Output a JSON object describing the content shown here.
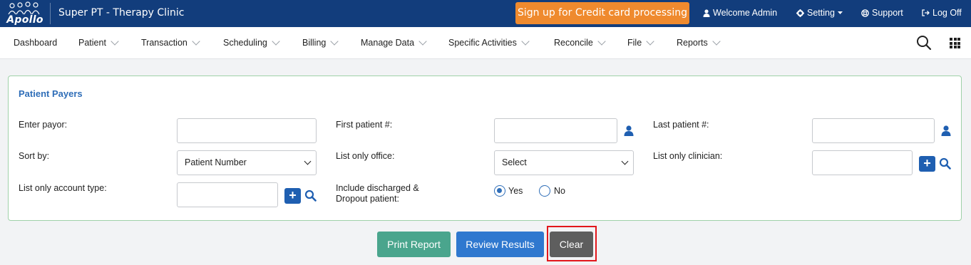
{
  "header": {
    "logo_text": "Apollo",
    "app_title": "Super PT - Therapy Clinic",
    "cta_label": "Sign up for Credit card processing",
    "welcome_label": "Welcome Admin",
    "setting_label": "Setting",
    "support_label": "Support",
    "logoff_label": "Log Off"
  },
  "nav": {
    "items": [
      {
        "label": "Dashboard"
      },
      {
        "label": "Patient"
      },
      {
        "label": "Transaction"
      },
      {
        "label": "Scheduling"
      },
      {
        "label": "Billing"
      },
      {
        "label": "Manage Data"
      },
      {
        "label": "Specific Activities"
      },
      {
        "label": "Reconcile"
      },
      {
        "label": "File"
      },
      {
        "label": "Reports"
      }
    ]
  },
  "form": {
    "title": "Patient Payers",
    "payor_label": "Enter payor:",
    "payor_value": "",
    "first_patient_label": "First patient #:",
    "first_patient_value": "",
    "last_patient_label": "Last patient #:",
    "last_patient_value": "",
    "sort_label": "Sort by:",
    "sort_value": "Patient Number",
    "office_label": "List only office:",
    "office_value": "Select",
    "clinician_label": "List only clinician:",
    "clinician_value": "",
    "account_type_label": "List only account type:",
    "account_type_value": "",
    "discharged_label_line1": "Include discharged &",
    "discharged_label_line2": "Dropout patient:",
    "yes_label": "Yes",
    "no_label": "No",
    "selected_option": "Yes"
  },
  "actions": {
    "print_label": "Print Report",
    "review_label": "Review Results",
    "clear_label": "Clear"
  },
  "colors": {
    "topbar": "#123d7c",
    "cta": "#ef8a2e",
    "accent": "#2f6eb8",
    "print_button": "#4aa58d",
    "review_button": "#2f78cf",
    "clear_button": "#5e5e5e",
    "highlight": "#e2161b"
  }
}
